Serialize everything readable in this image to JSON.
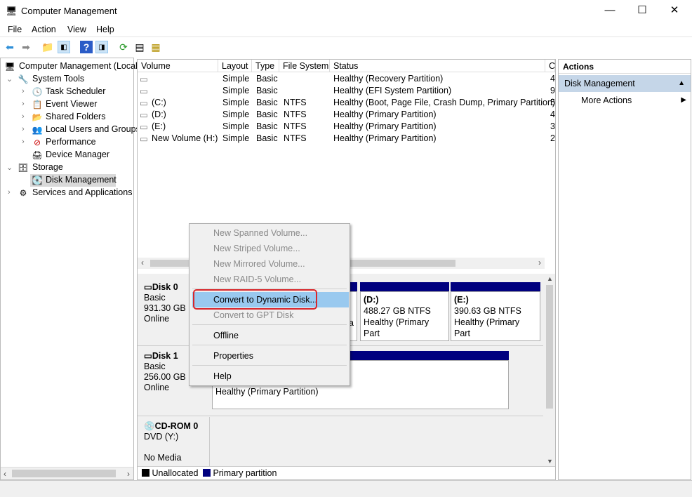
{
  "window": {
    "title": "Computer Management",
    "minimize": "—",
    "maximize": "☐",
    "close": "✕"
  },
  "menu": [
    "File",
    "Action",
    "View",
    "Help"
  ],
  "toolbar": [
    "back-icon",
    "forward-icon",
    "up-icon",
    "show-hide-tree-icon",
    "help-icon",
    "show-hide-action-icon",
    "refresh-icon",
    "properties-icon",
    "settings-icon"
  ],
  "tree": {
    "root": "Computer Management (Local",
    "system_tools": "System Tools",
    "items": [
      "Task Scheduler",
      "Event Viewer",
      "Shared Folders",
      "Local Users and Groups",
      "Performance",
      "Device Manager"
    ],
    "storage": "Storage",
    "disk_management": "Disk Management",
    "services": "Services and Applications"
  },
  "table": {
    "headers": [
      "Volume",
      "Layout",
      "Type",
      "File System",
      "Status",
      "C"
    ],
    "rows": [
      [
        "",
        "Simple",
        "Basic",
        "",
        "Healthy (Recovery Partition)",
        "4"
      ],
      [
        "",
        "Simple",
        "Basic",
        "",
        "Healthy (EFI System Partition)",
        "9"
      ],
      [
        "(C:)",
        "Simple",
        "Basic",
        "NTFS",
        "Healthy (Boot, Page File, Crash Dump, Primary Partition)",
        "5"
      ],
      [
        "(D:)",
        "Simple",
        "Basic",
        "NTFS",
        "Healthy (Primary Partition)",
        "4"
      ],
      [
        "(E:)",
        "Simple",
        "Basic",
        "NTFS",
        "Healthy (Primary Partition)",
        "3"
      ],
      [
        "New Volume (H:)",
        "Simple",
        "Basic",
        "NTFS",
        "Healthy (Primary Partition)",
        "2"
      ]
    ]
  },
  "disks": [
    {
      "name": "Disk 0",
      "type": "Basic",
      "size": "931.30 GB",
      "state": "Online",
      "partitions": [
        {
          "label": "",
          "size": "",
          "status": "a"
        },
        {
          "label": "(D:)",
          "size": "488.27 GB NTFS",
          "status": "Healthy (Primary Part"
        },
        {
          "label": "(E:)",
          "size": "390.63 GB NTFS",
          "status": "Healthy (Primary Part"
        }
      ]
    },
    {
      "name": "Disk 1",
      "type": "Basic",
      "size": "256.00 GB",
      "state": "Online",
      "partitions": [
        {
          "status": "Healthy (Primary Partition)"
        }
      ]
    },
    {
      "name": "CD-ROM 0",
      "type": "DVD (Y:)",
      "state": "No Media"
    }
  ],
  "legend": [
    {
      "label": "Unallocated",
      "color": "#000000"
    },
    {
      "label": "Primary partition",
      "color": "#00007f"
    }
  ],
  "actions": {
    "title": "Actions",
    "section": "Disk Management",
    "more": "More Actions"
  },
  "context_menu": {
    "items": [
      {
        "label": "New Spanned Volume...",
        "enabled": false
      },
      {
        "label": "New Striped Volume...",
        "enabled": false
      },
      {
        "label": "New Mirrored Volume...",
        "enabled": false
      },
      {
        "label": "New RAID-5 Volume...",
        "enabled": false
      },
      {
        "label": "Convert to Dynamic Disk...",
        "enabled": true,
        "highlighted": true
      },
      {
        "label": "Convert to GPT Disk",
        "enabled": false
      },
      {
        "label": "Offline",
        "enabled": true
      },
      {
        "label": "Properties",
        "enabled": true
      },
      {
        "label": "Help",
        "enabled": true
      }
    ]
  },
  "colors": {
    "highlight": "#99c9ef",
    "annotation": "#d9262b",
    "partition_bar": "#00007f",
    "action_header": "#c5d6e8"
  }
}
